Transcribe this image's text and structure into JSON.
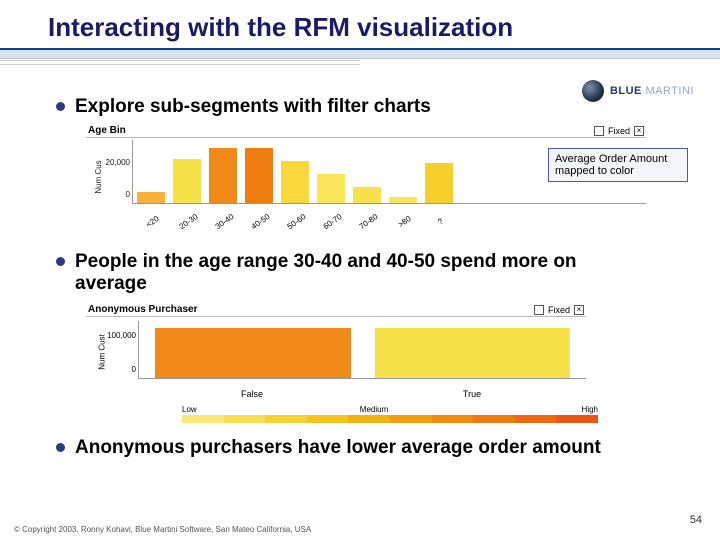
{
  "title": "Interacting with the RFM visualization",
  "logo": {
    "brand_a": "BLUE",
    "brand_b": "MARTINI"
  },
  "bullets": {
    "b1": "Explore sub-segments with filter charts",
    "b2": "People in the age range 30-40 and 40-50 spend more on average",
    "b3": "Anonymous purchasers have lower average order amount"
  },
  "chart1": {
    "title": "Age Bin",
    "fixed_label": "Fixed",
    "ylabel": "Num Cus",
    "yticks": [
      "20,000",
      "0"
    ],
    "categories": [
      "<20",
      "20-30",
      "30-40",
      "40-50",
      "50-60",
      "60-70",
      "70-80",
      ">80",
      "?"
    ]
  },
  "callout": "Average Order Amount mapped to color",
  "chart2": {
    "title": "Anonymous Purchaser",
    "fixed_label": "Fixed",
    "ylabel": "Num Cust",
    "yticks": [
      "100,000",
      "0"
    ],
    "categories": [
      "False",
      "True"
    ]
  },
  "legend": {
    "low": "Low",
    "medium": "Medium",
    "high": "High"
  },
  "footer": "© Copyright 2003, Ronny Kohavi, Blue Martini Software, San Mateo California, USA",
  "page_number": "54",
  "chart_data": [
    {
      "type": "bar",
      "title": "Age Bin",
      "ylabel": "Num Cus",
      "categories": [
        "<20",
        "20-30",
        "30-40",
        "40-50",
        "50-60",
        "60-70",
        "70-80",
        ">80",
        "?"
      ],
      "values": [
        6000,
        24000,
        30000,
        30000,
        23000,
        16000,
        9000,
        3000,
        22000
      ],
      "colors": [
        "#f6b23a",
        "#f8e24a",
        "#f28a1a",
        "#f07d12",
        "#f8d83a",
        "#f9e45a",
        "#f8e24a",
        "#f9e45a",
        "#f7cf2a"
      ],
      "ylim": [
        0,
        35000
      ],
      "color_encoding": "Average Order Amount"
    },
    {
      "type": "bar",
      "title": "Anonymous Purchaser",
      "ylabel": "Num Cust",
      "categories": [
        "False",
        "True"
      ],
      "values": [
        130000,
        130000
      ],
      "colors": [
        "#f28a1a",
        "#f8e24a"
      ],
      "ylim": [
        0,
        150000
      ],
      "color_encoding": "Average Order Amount"
    }
  ],
  "chart1_styles": {
    "b0": "height:11px;background:#f6b23a",
    "b1": "height:44px;background:#f8e24a",
    "b2": "height:55px;background:#f28a1a",
    "b3": "height:55px;background:#f07d12",
    "b4": "height:42px;background:#f8d83a",
    "b5": "height:29px;background:#f9e45a",
    "b6": "height:16px;background:#f8e24a",
    "b7": "height:6px;background:#f9e45a",
    "b8": "height:40px;background:#f7cf2a"
  },
  "chart2_styles": {
    "b0": "height:50px;background:#f28a1a",
    "b1": "height:50px;background:#f8e24a"
  },
  "legend_colors": {
    "c0": "background:#f9e878",
    "c1": "background:#f8df50",
    "c2": "background:#f7d232",
    "c3": "background:#f6c41a",
    "c4": "background:#f5b20c",
    "c5": "background:#f39e08",
    "c6": "background:#f18c0a",
    "c7": "background:#ef7a0e",
    "c8": "background:#ed6810",
    "c9": "background:#eb5614"
  }
}
